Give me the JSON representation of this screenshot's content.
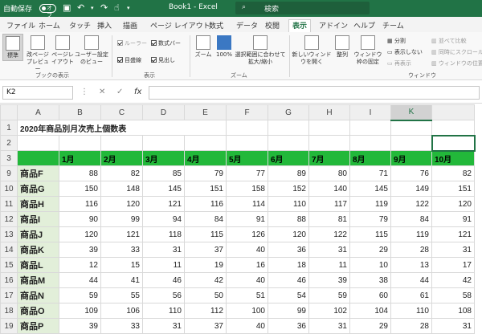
{
  "titlebar": {
    "autosave": "自動保存",
    "toggle": "オフ",
    "title": "Book1 - Excel",
    "search": "検索"
  },
  "tabs": [
    "ファイル",
    "ホーム",
    "タッチ",
    "挿入",
    "描画",
    "ページ レイアウト",
    "数式",
    "データ",
    "校閲",
    "表示",
    "アドイン",
    "ヘルプ",
    "チーム"
  ],
  "ribbon": {
    "standard": "標準",
    "page_break": "改ページプレビュー",
    "page_layout": "ページレイアウト",
    "user_view": "ユーザー設定のビュー",
    "group_book_views": "ブックの表示",
    "ruler": "ルーラー",
    "formula_bar": "数式バー",
    "gridlines": "目盛線",
    "headings": "見出し",
    "group_show": "表示",
    "zoom": "ズーム",
    "zoom100": "100%",
    "zoom_sel": "選択範囲に合わせて拡大/縮小",
    "group_zoom": "ズーム",
    "new_window": "新しいウィンドウを開く",
    "arrange": "整列",
    "freeze": "ウィンドウ枠の固定",
    "split": "分割",
    "hide": "表示しない",
    "unhide": "再表示",
    "side_by_side": "並べて比較",
    "sync_scroll": "同時にスクロール",
    "reset_pos": "ウィンドウの位置を",
    "group_window": "ウィンドウ"
  },
  "formula": {
    "namebox": "K2",
    "cancel": "✕",
    "enter": "✓",
    "fx": "fx",
    "value": ""
  },
  "columns": [
    "A",
    "B",
    "C",
    "D",
    "E",
    "F",
    "G",
    "H",
    "I",
    "J",
    "K",
    ""
  ],
  "title_cell": "2020年商品別月次売上個数表",
  "header_row": [
    "",
    "1月",
    "2月",
    "3月",
    "4月",
    "5月",
    "6月",
    "7月",
    "8月",
    "9月",
    "10月",
    ""
  ],
  "rows": [
    {
      "n": "9",
      "label": "商品F",
      "values": [
        "88",
        "82",
        "85",
        "79",
        "77",
        "89",
        "80",
        "71",
        "76",
        "82"
      ]
    },
    {
      "n": "10",
      "label": "商品G",
      "values": [
        "150",
        "148",
        "145",
        "151",
        "158",
        "152",
        "140",
        "145",
        "149",
        "151"
      ]
    },
    {
      "n": "11",
      "label": "商品H",
      "values": [
        "116",
        "120",
        "121",
        "116",
        "114",
        "110",
        "117",
        "119",
        "122",
        "120"
      ]
    },
    {
      "n": "12",
      "label": "商品I",
      "values": [
        "90",
        "99",
        "94",
        "84",
        "91",
        "88",
        "81",
        "79",
        "84",
        "91"
      ]
    },
    {
      "n": "13",
      "label": "商品J",
      "values": [
        "120",
        "121",
        "118",
        "115",
        "126",
        "120",
        "122",
        "115",
        "119",
        "121"
      ]
    },
    {
      "n": "14",
      "label": "商品K",
      "values": [
        "39",
        "33",
        "31",
        "37",
        "40",
        "36",
        "31",
        "29",
        "28",
        "31"
      ]
    },
    {
      "n": "15",
      "label": "商品L",
      "values": [
        "12",
        "15",
        "11",
        "19",
        "16",
        "18",
        "11",
        "10",
        "13",
        "17"
      ]
    },
    {
      "n": "16",
      "label": "商品M",
      "values": [
        "44",
        "41",
        "46",
        "42",
        "40",
        "46",
        "39",
        "38",
        "44",
        "42"
      ]
    },
    {
      "n": "17",
      "label": "商品N",
      "values": [
        "59",
        "55",
        "56",
        "50",
        "51",
        "54",
        "59",
        "60",
        "61",
        "58"
      ]
    },
    {
      "n": "18",
      "label": "商品O",
      "values": [
        "109",
        "106",
        "110",
        "112",
        "100",
        "99",
        "102",
        "104",
        "110",
        "108"
      ]
    },
    {
      "n": "19",
      "label": "商品P",
      "values": [
        "39",
        "33",
        "31",
        "37",
        "40",
        "36",
        "31",
        "29",
        "28",
        "31"
      ]
    }
  ],
  "colors": {
    "accent": "#217346",
    "header_fill": "#22b83a",
    "label_fill": "#e2efd9"
  }
}
